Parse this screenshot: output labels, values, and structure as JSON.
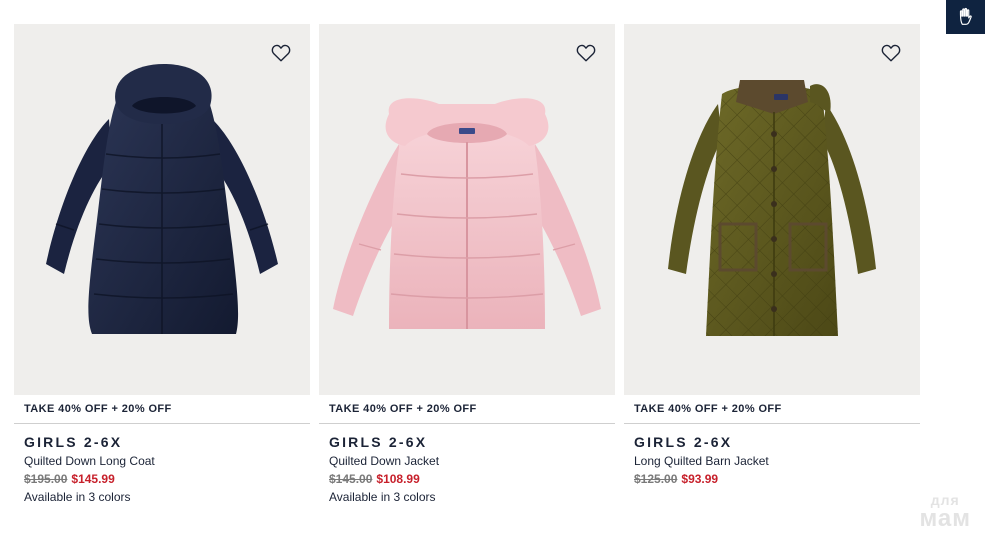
{
  "products": [
    {
      "promo": "TAKE 40% OFF + 20% OFF",
      "category": "GIRLS 2-6X",
      "name": "Quilted Down Long Coat",
      "price_old": "$195.00",
      "price_new": "$145.99",
      "colors": "Available in 3 colors",
      "image_icon": "navy-down-coat-image",
      "image_color": "#1d2540"
    },
    {
      "promo": "TAKE 40% OFF + 20% OFF",
      "category": "GIRLS 2-6X",
      "name": "Quilted Down Jacket",
      "price_old": "$145.00",
      "price_new": "$108.99",
      "colors": "Available in 3 colors",
      "image_icon": "pink-down-jacket-image",
      "image_color": "#f3c6cc"
    },
    {
      "promo": "TAKE 40% OFF + 20% OFF",
      "category": "GIRLS 2-6X",
      "name": "Long Quilted Barn Jacket",
      "price_old": "$125.00",
      "price_new": "$93.99",
      "colors": "",
      "image_icon": "olive-barn-jacket-image",
      "image_color": "#5f5a1e"
    }
  ],
  "icons": {
    "wishlist": "heart-icon",
    "side_tab": "hand-icon"
  },
  "watermark": {
    "line1": "для",
    "line2": "мам"
  },
  "colors": {
    "brand_navy": "#0f2340",
    "sale_red": "#c7202b",
    "image_background": "#efeeec"
  }
}
